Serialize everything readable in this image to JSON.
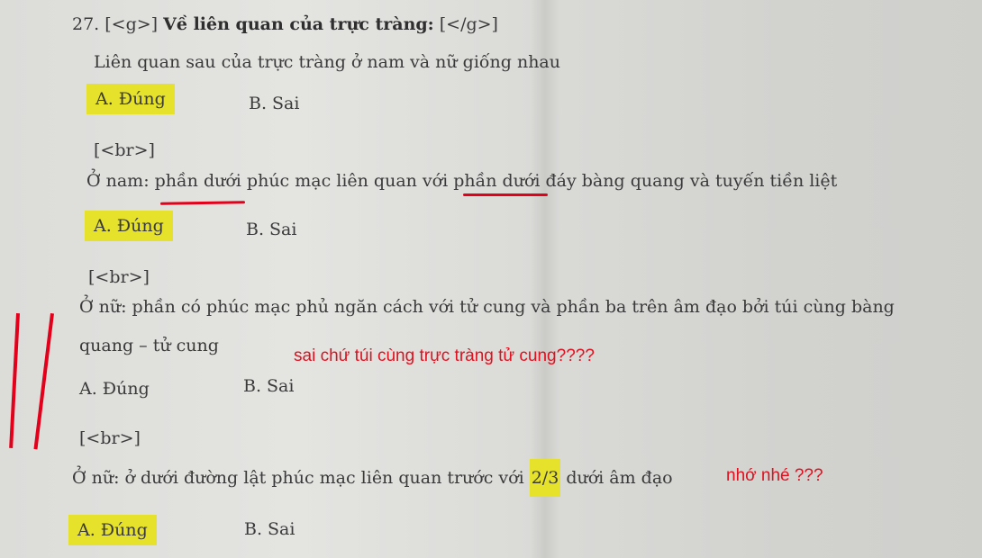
{
  "question": {
    "number": "27.",
    "open_tag": "[<g>]",
    "title": "Về liên quan của trực tràng:",
    "close_tag": "[</g>]"
  },
  "items": [
    {
      "statement": "Liên quan sau của trực tràng ở nam và nữ giống nhau",
      "option_a": "A. Đúng",
      "option_b": "B. Sai",
      "separator": "[<br>]"
    },
    {
      "statement_parts": [
        "Ở nam: ",
        "phần dưới",
        " phúc mạc liên quan với ",
        "phần dưới",
        " đáy bàng quang và tuyến tiền liệt"
      ],
      "option_a": "A. Đúng",
      "option_b": "B. Sai",
      "separator": "[<br>]"
    },
    {
      "statement_line1": "Ở nữ: phần có phúc mạc phủ ngăn cách với tử cung và phần ba trên âm đạo bởi túi cùng bàng",
      "statement_line2": "quang – tử cung",
      "option_a": "A. Đúng",
      "option_b": "B. Sai",
      "separator": "[<br>]"
    },
    {
      "statement_parts": [
        "Ở nữ: ở dưới đường lật phúc mạc liên quan trước với ",
        "2/3",
        " dưới âm đạo"
      ],
      "option_a": "A. Đúng",
      "option_b": "B. Sai"
    }
  ],
  "annotations": {
    "note1": "sai chứ túi cùng trực tràng tử cung????",
    "note2": "nhớ nhé ???"
  },
  "colors": {
    "highlight": "#e6e22c",
    "annotation_red": "#e0101f"
  }
}
